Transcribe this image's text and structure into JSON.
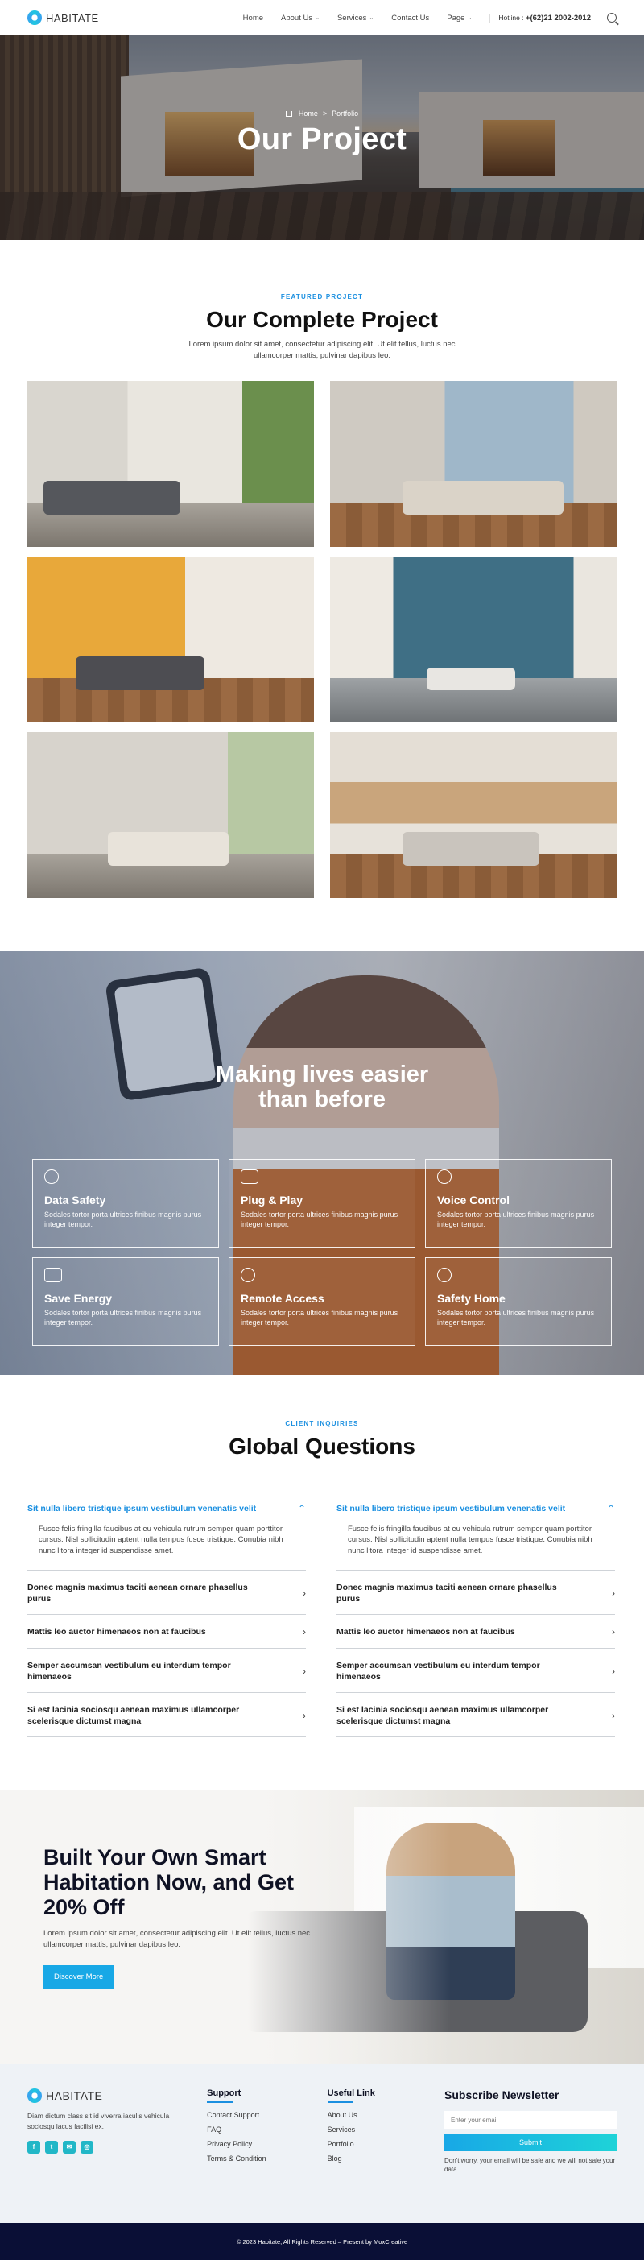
{
  "header": {
    "logo_text": "HABITATE",
    "nav": [
      {
        "label": "Home",
        "has_dropdown": false
      },
      {
        "label": "About Us",
        "has_dropdown": true
      },
      {
        "label": "Services",
        "has_dropdown": true
      },
      {
        "label": "Contact Us",
        "has_dropdown": false
      },
      {
        "label": "Page",
        "has_dropdown": true
      }
    ],
    "hotline_label": "Hotline :",
    "hotline_number": "+(62)21 2002-2012",
    "search_icon": "search-icon"
  },
  "hero": {
    "breadcrumb_home": "Home",
    "breadcrumb_sep": ">",
    "breadcrumb_current": "Portfolio",
    "title": "Our Project"
  },
  "projects": {
    "kicker": "FEATURED PROJECT",
    "title": "Our Complete Project",
    "description": "Lorem ipsum dolor sit amet, consectetur adipiscing elit. Ut elit tellus, luctus nec ullamcorper mattis, pulvinar dapibus leo."
  },
  "smart": {
    "title_line1": "Making lives easier",
    "title_line2": "than before",
    "features": [
      {
        "icon": "database-icon",
        "title": "Data Safety",
        "desc": "Sodales tortor porta ultrices finibus magnis purus integer tempor."
      },
      {
        "icon": "monitor-download-icon",
        "title": "Plug & Play",
        "desc": "Sodales tortor porta ultrices finibus magnis purus integer tempor."
      },
      {
        "icon": "microphone-icon",
        "title": "Voice Control",
        "desc": "Sodales tortor porta ultrices finibus magnis purus integer tempor."
      },
      {
        "icon": "battery-icon",
        "title": "Save Energy",
        "desc": "Sodales tortor porta ultrices finibus magnis purus integer tempor."
      },
      {
        "icon": "user-access-icon",
        "title": "Remote Access",
        "desc": "Sodales tortor porta ultrices finibus magnis purus integer tempor."
      },
      {
        "icon": "smart-home-icon",
        "title": "Safety Home",
        "desc": "Sodales tortor porta ultrices finibus magnis purus integer tempor."
      }
    ]
  },
  "faq": {
    "kicker": "CLIENT INQUIRIES",
    "title": "Global Questions",
    "columns": [
      {
        "items": [
          {
            "q": "Sit nulla libero tristique ipsum vestibulum venenatis velit",
            "a": "Fusce felis fringilla faucibus at eu vehicula rutrum semper quam porttitor cursus. Nisl sollicitudin aptent nulla tempus fusce tristique. Conubia nibh nunc litora integer id suspendisse amet.",
            "open": true
          },
          {
            "q": "Donec magnis maximus taciti aenean ornare phasellus purus",
            "a": "",
            "open": false
          },
          {
            "q": "Mattis leo auctor himenaeos non at faucibus",
            "a": "",
            "open": false
          },
          {
            "q": "Semper accumsan vestibulum eu interdum tempor himenaeos",
            "a": "",
            "open": false
          },
          {
            "q": "Si est lacinia sociosqu aenean maximus ullamcorper scelerisque dictumst magna",
            "a": "",
            "open": false
          }
        ]
      },
      {
        "items": [
          {
            "q": "Sit nulla libero tristique ipsum vestibulum venenatis velit",
            "a": "Fusce felis fringilla faucibus at eu vehicula rutrum semper quam porttitor cursus. Nisl sollicitudin aptent nulla tempus fusce tristique. Conubia nibh nunc litora integer id suspendisse amet.",
            "open": true
          },
          {
            "q": "Donec magnis maximus taciti aenean ornare phasellus purus",
            "a": "",
            "open": false
          },
          {
            "q": "Mattis leo auctor himenaeos non at faucibus",
            "a": "",
            "open": false
          },
          {
            "q": "Semper accumsan vestibulum eu interdum tempor himenaeos",
            "a": "",
            "open": false
          },
          {
            "q": "Si est lacinia sociosqu aenean maximus ullamcorper scelerisque dictumst magna",
            "a": "",
            "open": false
          }
        ]
      }
    ]
  },
  "cta": {
    "title": "Built Your Own Smart Habitation Now, and Get 20% Off",
    "desc": "Lorem ipsum dolor sit amet, consectetur adipiscing elit. Ut elit tellus, luctus nec ullamcorper mattis, pulvinar dapibus leo.",
    "button": "Discover More"
  },
  "footer": {
    "logo_text": "HABITATE",
    "desc": "Diam dictum class sit id viverra iaculis vehicula sociosqu lacus facilisi ex.",
    "social": [
      {
        "icon": "facebook-icon",
        "glyph": "f"
      },
      {
        "icon": "twitter-icon",
        "glyph": "t"
      },
      {
        "icon": "email-icon",
        "glyph": "✉"
      },
      {
        "icon": "instagram-icon",
        "glyph": "◎"
      }
    ],
    "support_title": "Support",
    "support_links": [
      "Contact Support",
      "FAQ",
      "Privacy Policy",
      "Terms & Condition"
    ],
    "useful_title": "Useful Link",
    "useful_links": [
      "About Us",
      "Services",
      "Portfolio",
      "Blog"
    ],
    "newsletter_title": "Subscribe Newsletter",
    "newsletter_placeholder": "Enter your email",
    "newsletter_button": "Submit",
    "newsletter_note": "Don't worry, your email will be safe and we will not sale your data.",
    "copyright": "© 2023 Habitate, All Rights Reserved – Present by MoxCreative"
  },
  "colors": {
    "accent": "#1a8fe0",
    "teal": "#21b7c7",
    "footer_bottom": "#0a0f36"
  }
}
